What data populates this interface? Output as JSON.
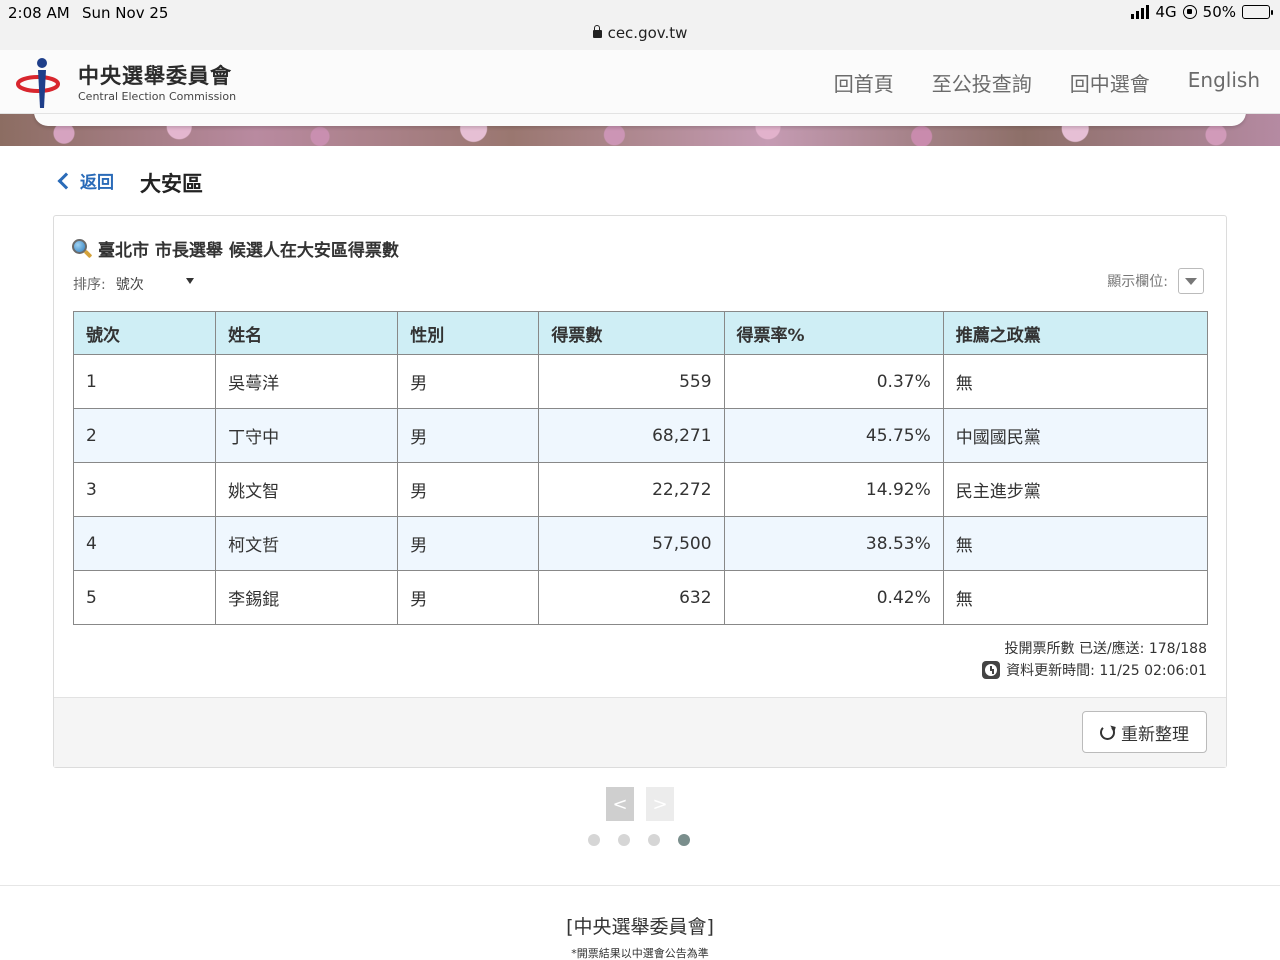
{
  "status_bar": {
    "time": "2:08 AM",
    "date": "Sun Nov 25",
    "network": "4G",
    "battery": "50%",
    "battery_level": 0.5
  },
  "browser": {
    "url": "cec.gov.tw"
  },
  "header": {
    "logo_zh": "中央選舉委員會",
    "logo_en": "Central Election Commission",
    "nav": [
      "回首頁",
      "至公投查詢",
      "回中選會",
      "English"
    ]
  },
  "page": {
    "back_label": "返回",
    "title": "大安區"
  },
  "panel": {
    "heading": "臺北市 市長選舉 候選人在大安區得票數",
    "sort_label": "排序:",
    "sort_value": "號次",
    "columns_label": "顯示欄位:",
    "table": {
      "headers": [
        "號次",
        "姓名",
        "性別",
        "得票數",
        "得票率%",
        "推薦之政黨"
      ],
      "rows": [
        [
          "1",
          "吳蕚洋",
          "男",
          "559",
          "0.37%",
          "無"
        ],
        [
          "2",
          "丁守中",
          "男",
          "68,271",
          "45.75%",
          "中國國民黨"
        ],
        [
          "3",
          "姚文智",
          "男",
          "22,272",
          "14.92%",
          "民主進步黨"
        ],
        [
          "4",
          "柯文哲",
          "男",
          "57,500",
          "38.53%",
          "無"
        ],
        [
          "5",
          "李錫錕",
          "男",
          "632",
          "0.42%",
          "無"
        ]
      ]
    },
    "stations": "投開票所數 已送/應送: 178/188",
    "updated": "資料更新時間: 11/25 02:06:01",
    "refresh_label": "重新整理"
  },
  "pager": {
    "prev": "<",
    "next": ">",
    "dots": 4,
    "active_dot": 4
  },
  "footer": {
    "title": "[中央選舉委員會]",
    "note": "*開票結果以中選會公告為準"
  },
  "colors": {
    "header_bg": "#cfeef5",
    "alt_row_bg": "#eff7fe",
    "link": "#2a6bb8"
  }
}
